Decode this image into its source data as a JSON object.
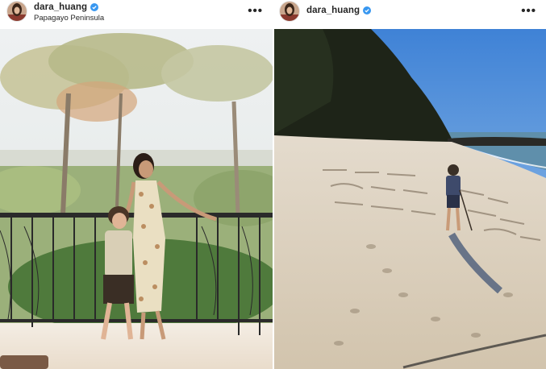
{
  "posts": [
    {
      "username": "dara_huang",
      "location": "Papagayo Peninsula",
      "more_label": "•••",
      "icons": {
        "verified": "verified-badge-icon",
        "more": "more-options-icon"
      }
    },
    {
      "username": "dara_huang",
      "location": "",
      "more_label": "•••",
      "icons": {
        "verified": "verified-badge-icon",
        "more": "more-options-icon"
      }
    }
  ],
  "colors": {
    "verified_blue": "#3897f0",
    "text": "#262626"
  }
}
